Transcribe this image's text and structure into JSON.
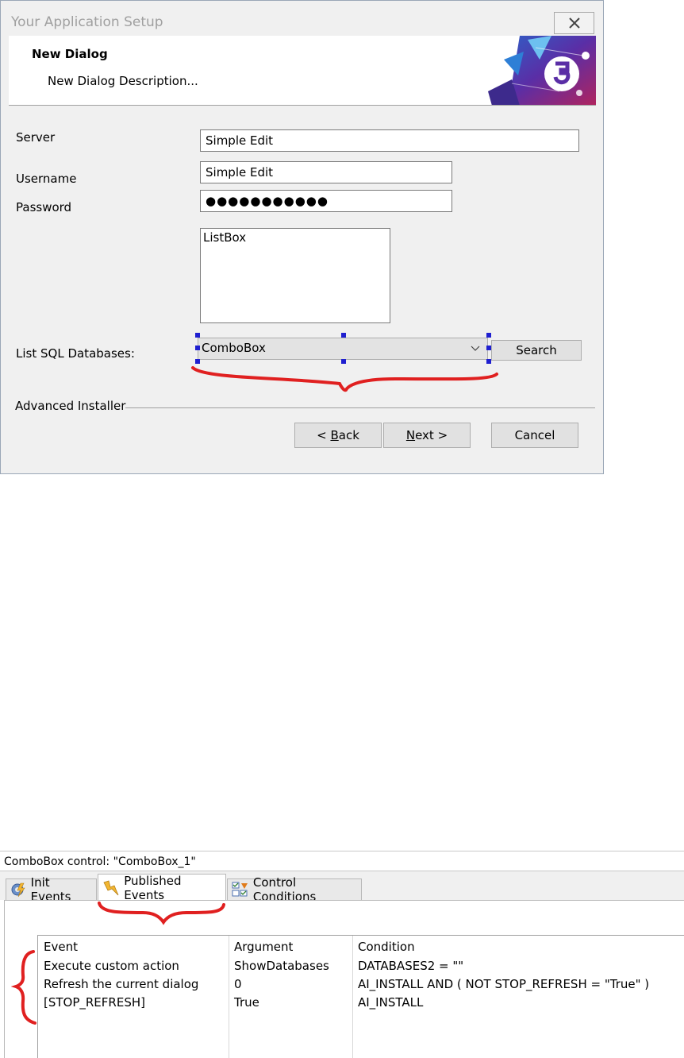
{
  "dialog": {
    "window_title": "Your Application Setup",
    "banner_title": "New Dialog",
    "banner_description": "New Dialog Description...",
    "server_label": "Server",
    "server_value": "Simple Edit",
    "username_label": "Username",
    "username_value": "Simple Edit",
    "password_label": "Password",
    "password_value": "●●●●●●●●●●●",
    "listbox_text": "ListBox",
    "list_sql_label": "List SQL Databases:",
    "combobox_value": "ComboBox",
    "search_button": "Search",
    "footer_label": "Advanced Installer",
    "back_button": {
      "prefix": "< ",
      "mnemonic": "B",
      "rest": "ack"
    },
    "next_button": {
      "mnemonic": "N",
      "rest": "ext >"
    },
    "cancel_button": "Cancel"
  },
  "panel": {
    "caption": "ComboBox control: \"ComboBox_1\"",
    "tabs": [
      {
        "label": "Init Events",
        "icon": "gear-lightning-icon"
      },
      {
        "label": "Published Events",
        "icon": "lightning-icon",
        "active": true
      },
      {
        "label": "Control Conditions",
        "icon": "checklist-icon"
      }
    ],
    "table": {
      "headers": [
        "Event",
        "Argument",
        "Condition"
      ],
      "rows": [
        [
          "Execute custom action",
          "ShowDatabases",
          "DATABASES2 = \"\""
        ],
        [
          "Refresh the current dialog",
          "0",
          "AI_INSTALL AND ( NOT STOP_REFRESH = \"True\" )"
        ],
        [
          "[STOP_REFRESH]",
          "True",
          "AI_INSTALL"
        ]
      ]
    }
  },
  "colors": {
    "annotation_red": "#e02020",
    "selection_handle": "#1f1fd0"
  }
}
